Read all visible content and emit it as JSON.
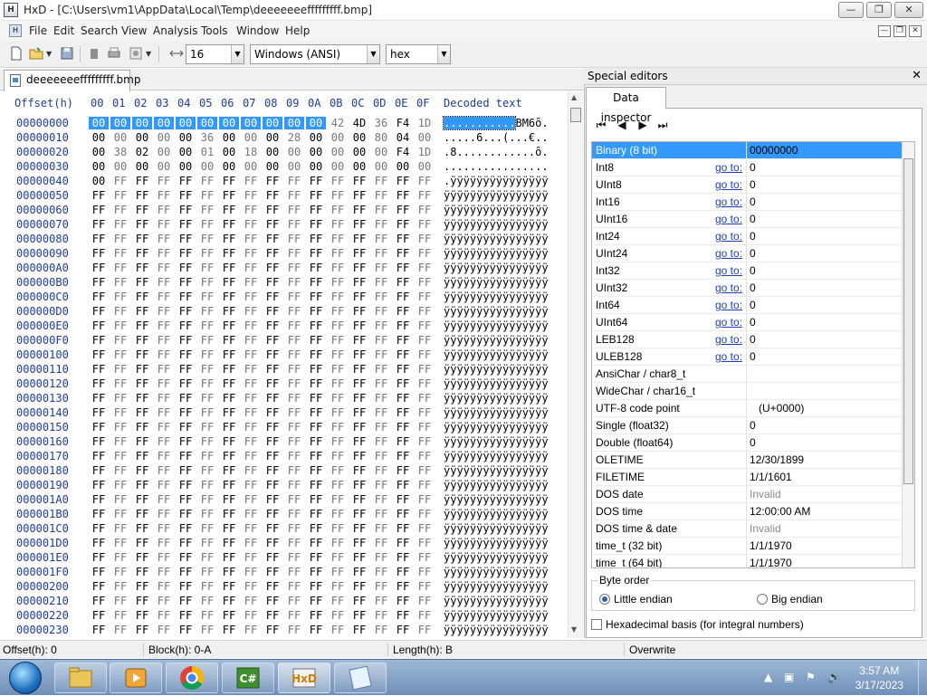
{
  "window": {
    "title": "HxD - [C:\\Users\\vm1\\AppData\\Local\\Temp\\deeeeeeefffffffff.bmp]"
  },
  "menu": [
    "File",
    "Edit",
    "Search",
    "View",
    "Analysis",
    "Tools",
    "Window",
    "Help"
  ],
  "toolbar": {
    "bytes_per_row": "16",
    "charset": "Windows (ANSI)",
    "offset_base": "hex"
  },
  "file_tab": "deeeeeeefffffffff.bmp",
  "hex_header": {
    "offset_label": "Offset(h)",
    "columns": [
      "00",
      "01",
      "02",
      "03",
      "04",
      "05",
      "06",
      "07",
      "08",
      "09",
      "0A",
      "0B",
      "0C",
      "0D",
      "0E",
      "0F"
    ],
    "decoded_label": "Decoded text"
  },
  "hex_rows": [
    {
      "offset": "00000000",
      "bytes": [
        "00",
        "00",
        "00",
        "00",
        "00",
        "00",
        "00",
        "00",
        "00",
        "00",
        "00",
        "42",
        "4D",
        "36",
        "F4",
        "1D"
      ],
      "text": "...........BM6ô."
    },
    {
      "offset": "00000010",
      "bytes": [
        "00",
        "00",
        "00",
        "00",
        "00",
        "36",
        "00",
        "00",
        "00",
        "28",
        "00",
        "00",
        "00",
        "80",
        "04",
        "00"
      ],
      "text": ".....6...(...€.."
    },
    {
      "offset": "00000020",
      "bytes": [
        "00",
        "38",
        "02",
        "00",
        "00",
        "01",
        "00",
        "18",
        "00",
        "00",
        "00",
        "00",
        "00",
        "00",
        "F4",
        "1D"
      ],
      "text": ".8............ô."
    },
    {
      "offset": "00000030",
      "bytes": [
        "00",
        "00",
        "00",
        "00",
        "00",
        "00",
        "00",
        "00",
        "00",
        "00",
        "00",
        "00",
        "00",
        "00",
        "00",
        "00"
      ],
      "text": "................"
    },
    {
      "offset": "00000040",
      "bytes": [
        "00",
        "FF",
        "FF",
        "FF",
        "FF",
        "FF",
        "FF",
        "FF",
        "FF",
        "FF",
        "FF",
        "FF",
        "FF",
        "FF",
        "FF",
        "FF"
      ],
      "text": ".ÿÿÿÿÿÿÿÿÿÿÿÿÿÿÿ"
    },
    {
      "offset": "00000050",
      "bytes": [
        "FF",
        "FF",
        "FF",
        "FF",
        "FF",
        "FF",
        "FF",
        "FF",
        "FF",
        "FF",
        "FF",
        "FF",
        "FF",
        "FF",
        "FF",
        "FF"
      ],
      "text": "ÿÿÿÿÿÿÿÿÿÿÿÿÿÿÿÿ"
    },
    {
      "offset": "00000060",
      "bytes": [
        "FF",
        "FF",
        "FF",
        "FF",
        "FF",
        "FF",
        "FF",
        "FF",
        "FF",
        "FF",
        "FF",
        "FF",
        "FF",
        "FF",
        "FF",
        "FF"
      ],
      "text": "ÿÿÿÿÿÿÿÿÿÿÿÿÿÿÿÿ"
    },
    {
      "offset": "00000070",
      "bytes": [
        "FF",
        "FF",
        "FF",
        "FF",
        "FF",
        "FF",
        "FF",
        "FF",
        "FF",
        "FF",
        "FF",
        "FF",
        "FF",
        "FF",
        "FF",
        "FF"
      ],
      "text": "ÿÿÿÿÿÿÿÿÿÿÿÿÿÿÿÿ"
    },
    {
      "offset": "00000080",
      "bytes": [
        "FF",
        "FF",
        "FF",
        "FF",
        "FF",
        "FF",
        "FF",
        "FF",
        "FF",
        "FF",
        "FF",
        "FF",
        "FF",
        "FF",
        "FF",
        "FF"
      ],
      "text": "ÿÿÿÿÿÿÿÿÿÿÿÿÿÿÿÿ"
    },
    {
      "offset": "00000090",
      "bytes": [
        "FF",
        "FF",
        "FF",
        "FF",
        "FF",
        "FF",
        "FF",
        "FF",
        "FF",
        "FF",
        "FF",
        "FF",
        "FF",
        "FF",
        "FF",
        "FF"
      ],
      "text": "ÿÿÿÿÿÿÿÿÿÿÿÿÿÿÿÿ"
    },
    {
      "offset": "000000A0",
      "bytes": [
        "FF",
        "FF",
        "FF",
        "FF",
        "FF",
        "FF",
        "FF",
        "FF",
        "FF",
        "FF",
        "FF",
        "FF",
        "FF",
        "FF",
        "FF",
        "FF"
      ],
      "text": "ÿÿÿÿÿÿÿÿÿÿÿÿÿÿÿÿ"
    },
    {
      "offset": "000000B0",
      "bytes": [
        "FF",
        "FF",
        "FF",
        "FF",
        "FF",
        "FF",
        "FF",
        "FF",
        "FF",
        "FF",
        "FF",
        "FF",
        "FF",
        "FF",
        "FF",
        "FF"
      ],
      "text": "ÿÿÿÿÿÿÿÿÿÿÿÿÿÿÿÿ"
    },
    {
      "offset": "000000C0",
      "bytes": [
        "FF",
        "FF",
        "FF",
        "FF",
        "FF",
        "FF",
        "FF",
        "FF",
        "FF",
        "FF",
        "FF",
        "FF",
        "FF",
        "FF",
        "FF",
        "FF"
      ],
      "text": "ÿÿÿÿÿÿÿÿÿÿÿÿÿÿÿÿ"
    },
    {
      "offset": "000000D0",
      "bytes": [
        "FF",
        "FF",
        "FF",
        "FF",
        "FF",
        "FF",
        "FF",
        "FF",
        "FF",
        "FF",
        "FF",
        "FF",
        "FF",
        "FF",
        "FF",
        "FF"
      ],
      "text": "ÿÿÿÿÿÿÿÿÿÿÿÿÿÿÿÿ"
    },
    {
      "offset": "000000E0",
      "bytes": [
        "FF",
        "FF",
        "FF",
        "FF",
        "FF",
        "FF",
        "FF",
        "FF",
        "FF",
        "FF",
        "FF",
        "FF",
        "FF",
        "FF",
        "FF",
        "FF"
      ],
      "text": "ÿÿÿÿÿÿÿÿÿÿÿÿÿÿÿÿ"
    },
    {
      "offset": "000000F0",
      "bytes": [
        "FF",
        "FF",
        "FF",
        "FF",
        "FF",
        "FF",
        "FF",
        "FF",
        "FF",
        "FF",
        "FF",
        "FF",
        "FF",
        "FF",
        "FF",
        "FF"
      ],
      "text": "ÿÿÿÿÿÿÿÿÿÿÿÿÿÿÿÿ"
    },
    {
      "offset": "00000100",
      "bytes": [
        "FF",
        "FF",
        "FF",
        "FF",
        "FF",
        "FF",
        "FF",
        "FF",
        "FF",
        "FF",
        "FF",
        "FF",
        "FF",
        "FF",
        "FF",
        "FF"
      ],
      "text": "ÿÿÿÿÿÿÿÿÿÿÿÿÿÿÿÿ"
    },
    {
      "offset": "00000110",
      "bytes": [
        "FF",
        "FF",
        "FF",
        "FF",
        "FF",
        "FF",
        "FF",
        "FF",
        "FF",
        "FF",
        "FF",
        "FF",
        "FF",
        "FF",
        "FF",
        "FF"
      ],
      "text": "ÿÿÿÿÿÿÿÿÿÿÿÿÿÿÿÿ"
    },
    {
      "offset": "00000120",
      "bytes": [
        "FF",
        "FF",
        "FF",
        "FF",
        "FF",
        "FF",
        "FF",
        "FF",
        "FF",
        "FF",
        "FF",
        "FF",
        "FF",
        "FF",
        "FF",
        "FF"
      ],
      "text": "ÿÿÿÿÿÿÿÿÿÿÿÿÿÿÿÿ"
    },
    {
      "offset": "00000130",
      "bytes": [
        "FF",
        "FF",
        "FF",
        "FF",
        "FF",
        "FF",
        "FF",
        "FF",
        "FF",
        "FF",
        "FF",
        "FF",
        "FF",
        "FF",
        "FF",
        "FF"
      ],
      "text": "ÿÿÿÿÿÿÿÿÿÿÿÿÿÿÿÿ"
    },
    {
      "offset": "00000140",
      "bytes": [
        "FF",
        "FF",
        "FF",
        "FF",
        "FF",
        "FF",
        "FF",
        "FF",
        "FF",
        "FF",
        "FF",
        "FF",
        "FF",
        "FF",
        "FF",
        "FF"
      ],
      "text": "ÿÿÿÿÿÿÿÿÿÿÿÿÿÿÿÿ"
    },
    {
      "offset": "00000150",
      "bytes": [
        "FF",
        "FF",
        "FF",
        "FF",
        "FF",
        "FF",
        "FF",
        "FF",
        "FF",
        "FF",
        "FF",
        "FF",
        "FF",
        "FF",
        "FF",
        "FF"
      ],
      "text": "ÿÿÿÿÿÿÿÿÿÿÿÿÿÿÿÿ"
    },
    {
      "offset": "00000160",
      "bytes": [
        "FF",
        "FF",
        "FF",
        "FF",
        "FF",
        "FF",
        "FF",
        "FF",
        "FF",
        "FF",
        "FF",
        "FF",
        "FF",
        "FF",
        "FF",
        "FF"
      ],
      "text": "ÿÿÿÿÿÿÿÿÿÿÿÿÿÿÿÿ"
    },
    {
      "offset": "00000170",
      "bytes": [
        "FF",
        "FF",
        "FF",
        "FF",
        "FF",
        "FF",
        "FF",
        "FF",
        "FF",
        "FF",
        "FF",
        "FF",
        "FF",
        "FF",
        "FF",
        "FF"
      ],
      "text": "ÿÿÿÿÿÿÿÿÿÿÿÿÿÿÿÿ"
    },
    {
      "offset": "00000180",
      "bytes": [
        "FF",
        "FF",
        "FF",
        "FF",
        "FF",
        "FF",
        "FF",
        "FF",
        "FF",
        "FF",
        "FF",
        "FF",
        "FF",
        "FF",
        "FF",
        "FF"
      ],
      "text": "ÿÿÿÿÿÿÿÿÿÿÿÿÿÿÿÿ"
    },
    {
      "offset": "00000190",
      "bytes": [
        "FF",
        "FF",
        "FF",
        "FF",
        "FF",
        "FF",
        "FF",
        "FF",
        "FF",
        "FF",
        "FF",
        "FF",
        "FF",
        "FF",
        "FF",
        "FF"
      ],
      "text": "ÿÿÿÿÿÿÿÿÿÿÿÿÿÿÿÿ"
    },
    {
      "offset": "000001A0",
      "bytes": [
        "FF",
        "FF",
        "FF",
        "FF",
        "FF",
        "FF",
        "FF",
        "FF",
        "FF",
        "FF",
        "FF",
        "FF",
        "FF",
        "FF",
        "FF",
        "FF"
      ],
      "text": "ÿÿÿÿÿÿÿÿÿÿÿÿÿÿÿÿ"
    },
    {
      "offset": "000001B0",
      "bytes": [
        "FF",
        "FF",
        "FF",
        "FF",
        "FF",
        "FF",
        "FF",
        "FF",
        "FF",
        "FF",
        "FF",
        "FF",
        "FF",
        "FF",
        "FF",
        "FF"
      ],
      "text": "ÿÿÿÿÿÿÿÿÿÿÿÿÿÿÿÿ"
    },
    {
      "offset": "000001C0",
      "bytes": [
        "FF",
        "FF",
        "FF",
        "FF",
        "FF",
        "FF",
        "FF",
        "FF",
        "FF",
        "FF",
        "FF",
        "FF",
        "FF",
        "FF",
        "FF",
        "FF"
      ],
      "text": "ÿÿÿÿÿÿÿÿÿÿÿÿÿÿÿÿ"
    },
    {
      "offset": "000001D0",
      "bytes": [
        "FF",
        "FF",
        "FF",
        "FF",
        "FF",
        "FF",
        "FF",
        "FF",
        "FF",
        "FF",
        "FF",
        "FF",
        "FF",
        "FF",
        "FF",
        "FF"
      ],
      "text": "ÿÿÿÿÿÿÿÿÿÿÿÿÿÿÿÿ"
    },
    {
      "offset": "000001E0",
      "bytes": [
        "FF",
        "FF",
        "FF",
        "FF",
        "FF",
        "FF",
        "FF",
        "FF",
        "FF",
        "FF",
        "FF",
        "FF",
        "FF",
        "FF",
        "FF",
        "FF"
      ],
      "text": "ÿÿÿÿÿÿÿÿÿÿÿÿÿÿÿÿ"
    },
    {
      "offset": "000001F0",
      "bytes": [
        "FF",
        "FF",
        "FF",
        "FF",
        "FF",
        "FF",
        "FF",
        "FF",
        "FF",
        "FF",
        "FF",
        "FF",
        "FF",
        "FF",
        "FF",
        "FF"
      ],
      "text": "ÿÿÿÿÿÿÿÿÿÿÿÿÿÿÿÿ"
    },
    {
      "offset": "00000200",
      "bytes": [
        "FF",
        "FF",
        "FF",
        "FF",
        "FF",
        "FF",
        "FF",
        "FF",
        "FF",
        "FF",
        "FF",
        "FF",
        "FF",
        "FF",
        "FF",
        "FF"
      ],
      "text": "ÿÿÿÿÿÿÿÿÿÿÿÿÿÿÿÿ"
    },
    {
      "offset": "00000210",
      "bytes": [
        "FF",
        "FF",
        "FF",
        "FF",
        "FF",
        "FF",
        "FF",
        "FF",
        "FF",
        "FF",
        "FF",
        "FF",
        "FF",
        "FF",
        "FF",
        "FF"
      ],
      "text": "ÿÿÿÿÿÿÿÿÿÿÿÿÿÿÿÿ"
    },
    {
      "offset": "00000220",
      "bytes": [
        "FF",
        "FF",
        "FF",
        "FF",
        "FF",
        "FF",
        "FF",
        "FF",
        "FF",
        "FF",
        "FF",
        "FF",
        "FF",
        "FF",
        "FF",
        "FF"
      ],
      "text": "ÿÿÿÿÿÿÿÿÿÿÿÿÿÿÿÿ"
    },
    {
      "offset": "00000230",
      "bytes": [
        "FF",
        "FF",
        "FF",
        "FF",
        "FF",
        "FF",
        "FF",
        "FF",
        "FF",
        "FF",
        "FF",
        "FF",
        "FF",
        "FF",
        "FF",
        "FF"
      ],
      "text": "ÿÿÿÿÿÿÿÿÿÿÿÿÿÿÿÿ"
    }
  ],
  "special_editors": {
    "title": "Special editors",
    "tab": "Data inspector",
    "goto_label": "go to:",
    "rows": [
      {
        "label": "Binary (8 bit)",
        "value": "00000000",
        "goto": false,
        "selected": true
      },
      {
        "label": "Int8",
        "value": "0",
        "goto": true
      },
      {
        "label": "UInt8",
        "value": "0",
        "goto": true
      },
      {
        "label": "Int16",
        "value": "0",
        "goto": true
      },
      {
        "label": "UInt16",
        "value": "0",
        "goto": true
      },
      {
        "label": "Int24",
        "value": "0",
        "goto": true
      },
      {
        "label": "UInt24",
        "value": "0",
        "goto": true
      },
      {
        "label": "Int32",
        "value": "0",
        "goto": true
      },
      {
        "label": "UInt32",
        "value": "0",
        "goto": true
      },
      {
        "label": "Int64",
        "value": "0",
        "goto": true
      },
      {
        "label": "UInt64",
        "value": "0",
        "goto": true
      },
      {
        "label": "LEB128",
        "value": "0",
        "goto": true
      },
      {
        "label": "ULEB128",
        "value": "0",
        "goto": true
      },
      {
        "label": "AnsiChar / char8_t",
        "value": "",
        "goto": false
      },
      {
        "label": "WideChar / char16_t",
        "value": "",
        "goto": false
      },
      {
        "label": "UTF-8 code point",
        "value": "   (U+0000)",
        "goto": false
      },
      {
        "label": "Single (float32)",
        "value": "0",
        "goto": false
      },
      {
        "label": "Double (float64)",
        "value": "0",
        "goto": false
      },
      {
        "label": "OLETIME",
        "value": "12/30/1899",
        "goto": false
      },
      {
        "label": "FILETIME",
        "value": "1/1/1601",
        "goto": false
      },
      {
        "label": "DOS date",
        "value": "Invalid",
        "goto": false,
        "gray": true
      },
      {
        "label": "DOS time",
        "value": "12:00:00 AM",
        "goto": false
      },
      {
        "label": "DOS time & date",
        "value": "Invalid",
        "goto": false,
        "gray": true
      },
      {
        "label": "time_t (32 bit)",
        "value": "1/1/1970",
        "goto": false
      },
      {
        "label": "time_t (64 bit)",
        "value": "1/1/1970",
        "goto": false
      }
    ],
    "byte_order_label": "Byte order",
    "little_endian": "Little endian",
    "big_endian": "Big endian",
    "hex_basis_label": "Hexadecimal basis (for integral numbers)"
  },
  "status": {
    "offset": "Offset(h): 0",
    "block": "Block(h): 0-A",
    "length": "Length(h): B",
    "mode": "Overwrite"
  },
  "clock": {
    "time": "3:57 AM",
    "date": "3/17/2023"
  }
}
